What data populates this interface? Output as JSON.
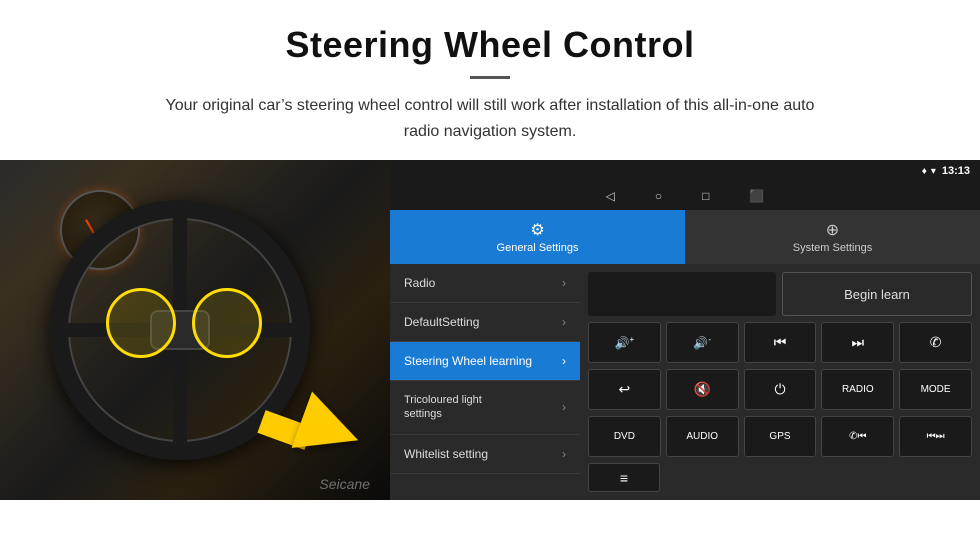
{
  "header": {
    "title": "Steering Wheel Control",
    "subtitle": "Your original car’s steering wheel control will still work after installation of this all-in-one auto radio navigation system."
  },
  "device": {
    "status_bar": {
      "time": "13:13",
      "wifi_icon": "▾",
      "signal_icon": "▾"
    },
    "nav_items": [
      "◁",
      "○",
      "□",
      "⬛"
    ],
    "tabs": [
      {
        "label": "General Settings",
        "active": true,
        "icon": "⚙"
      },
      {
        "label": "System Settings",
        "active": false,
        "icon": "⊕"
      }
    ],
    "menu_items": [
      {
        "label": "Radio",
        "active": false
      },
      {
        "label": "DefaultSetting",
        "active": false
      },
      {
        "label": "Steering Wheel learning",
        "active": true
      },
      {
        "label": "Tricoloured light settings",
        "active": false
      },
      {
        "label": "Whitelist setting",
        "active": false
      }
    ],
    "right_panel": {
      "begin_learn_label": "Begin learn",
      "buttons_row1": [
        {
          "label": "🔊+",
          "type": "icon"
        },
        {
          "label": "🔊-",
          "type": "icon"
        },
        {
          "label": "⏮",
          "type": "icon"
        },
        {
          "label": "⏭",
          "type": "icon"
        },
        {
          "label": "📞",
          "type": "icon"
        }
      ],
      "buttons_row2": [
        {
          "label": "↩",
          "type": "icon"
        },
        {
          "label": "🔇",
          "type": "icon"
        },
        {
          "label": "⏻",
          "type": "icon"
        },
        {
          "label": "RADIO",
          "type": "text"
        },
        {
          "label": "MODE",
          "type": "text"
        }
      ],
      "buttons_row3": [
        {
          "label": "DVD",
          "type": "text"
        },
        {
          "label": "AUDIO",
          "type": "text"
        },
        {
          "label": "GPS",
          "type": "text"
        },
        {
          "label": "📞⏮",
          "type": "icon"
        },
        {
          "label": "⏮⏭",
          "type": "icon"
        }
      ],
      "buttons_row4": [
        {
          "label": "≡",
          "type": "icon"
        }
      ]
    }
  },
  "watermark": "Seicane",
  "icons": {
    "volume_up": "🔊+",
    "volume_down": "🔊-",
    "prev": "⏮",
    "next": "⏭",
    "phone": "✆",
    "back": "↩",
    "mute": "🔇",
    "power": "⏻",
    "menu_grid": "≡",
    "chevron": "›"
  },
  "colors": {
    "active_blue": "#1a7bd4",
    "dark_bg": "#1a1a1a",
    "medium_bg": "#2a2a2a",
    "text_light": "#ddd",
    "border": "#444"
  }
}
